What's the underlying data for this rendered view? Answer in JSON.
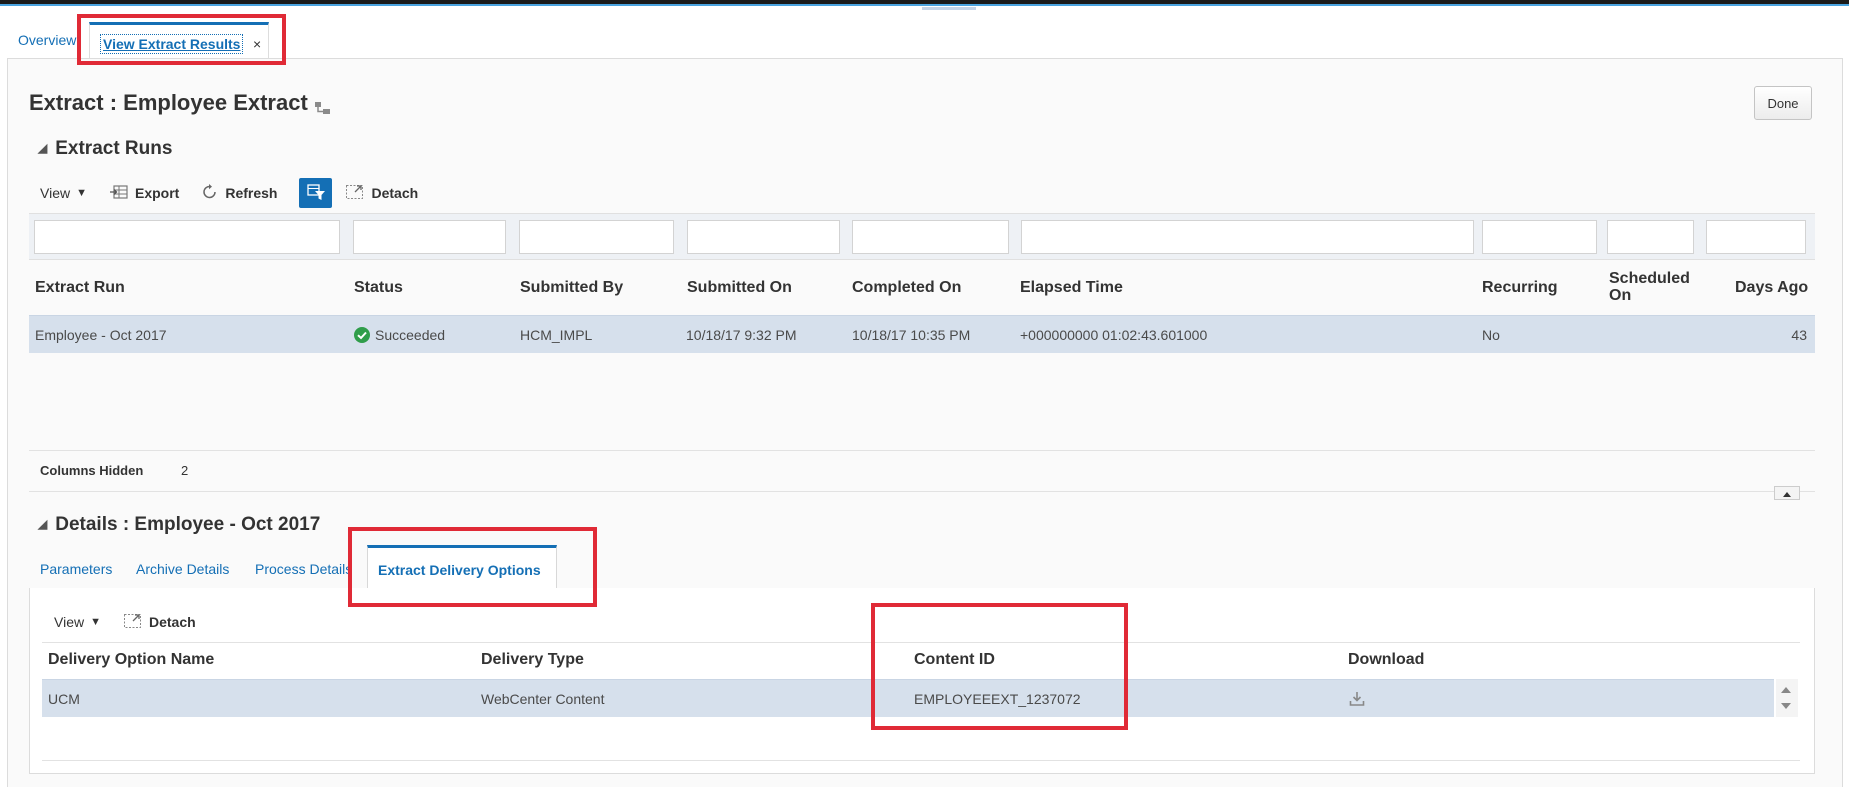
{
  "page_tabs": {
    "overview": "Overview",
    "active": "View Extract Results",
    "close": "×"
  },
  "page": {
    "title": "Extract : Employee Extract",
    "done_label": "Done"
  },
  "runs_section": {
    "title": "Extract Runs",
    "toolbar": {
      "view": "View",
      "export": "Export",
      "refresh": "Refresh",
      "detach": "Detach"
    },
    "columns": {
      "extract_run": "Extract Run",
      "status": "Status",
      "submitted_by": "Submitted By",
      "submitted_on": "Submitted On",
      "completed_on": "Completed On",
      "elapsed_time": "Elapsed Time",
      "recurring": "Recurring",
      "scheduled_on": "Scheduled On",
      "days_ago": "Days Ago"
    },
    "row": {
      "extract_run": "Employee - Oct 2017",
      "status": "Succeeded",
      "submitted_by": "HCM_IMPL",
      "submitted_on": "10/18/17 9:32 PM",
      "completed_on": "10/18/17 10:35 PM",
      "elapsed_time": "+000000000 01:02:43.601000",
      "recurring": "No",
      "scheduled_on": "",
      "days_ago": "43"
    },
    "columns_hidden_label": "Columns Hidden",
    "columns_hidden_value": "2"
  },
  "details_section": {
    "title": "Details : Employee - Oct 2017",
    "tabs": {
      "parameters": "Parameters",
      "archive_details": "Archive Details",
      "process_details": "Process Details",
      "delivery_options": "Extract Delivery Options"
    },
    "toolbar": {
      "view": "View",
      "detach": "Detach"
    },
    "columns": {
      "delivery_option_name": "Delivery Option Name",
      "delivery_type": "Delivery Type",
      "content_id": "Content ID",
      "download": "Download"
    },
    "row": {
      "delivery_option_name": "UCM",
      "delivery_type": "WebCenter Content",
      "content_id": "EMPLOYEEEXT_1237072"
    }
  },
  "colors": {
    "accent": "#146fb5",
    "selected_row": "#d6e0ec",
    "highlight": "#e02a36",
    "success": "#2f9d4a"
  }
}
